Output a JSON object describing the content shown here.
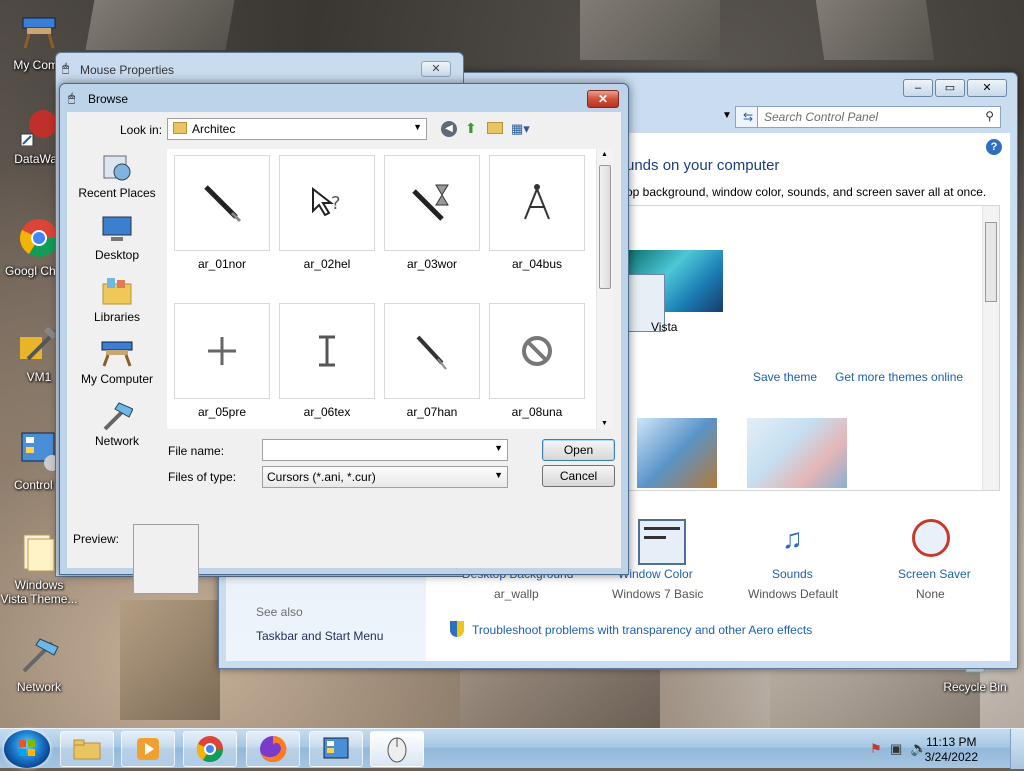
{
  "desktop": {
    "icons": [
      {
        "label": "My Comp",
        "icon": "computer-icon"
      },
      {
        "label": "DataWag",
        "icon": "shortcut-icon"
      },
      {
        "label": "Googl Chron",
        "icon": "chrome-icon"
      },
      {
        "label": "VM1",
        "icon": "tools-icon"
      },
      {
        "label": "Control P",
        "icon": "control-panel-icon"
      },
      {
        "label": "Windows Vista Theme...",
        "icon": "folder-icon"
      },
      {
        "label": "Network",
        "icon": "network-icon"
      },
      {
        "label": "Recycle Bin",
        "icon": "recycle-bin-icon"
      }
    ]
  },
  "control_panel": {
    "search_placeholder": "Search Control Panel",
    "heading": "unds on your computer",
    "subheading": "op background, window color, sounds, and screen saver all at once.",
    "theme_name": "Vista",
    "save_theme": "Save theme",
    "get_more_themes": "Get more themes online",
    "bottom_items": [
      {
        "label": "Desktop Background",
        "value": "ar_wallp"
      },
      {
        "label": "Window Color",
        "value": "Windows 7 Basic"
      },
      {
        "label": "Sounds",
        "value": "Windows Default"
      },
      {
        "label": "Screen Saver",
        "value": "None"
      }
    ],
    "see_also": "See also",
    "taskbar_link": "Taskbar and Start Menu",
    "troubleshoot": "Troubleshoot problems with transparency and other Aero effects"
  },
  "mouse_properties": {
    "title": "Mouse Properties",
    "close": "✕"
  },
  "browse": {
    "title": "Browse",
    "close": "✕",
    "look_in_label": "Look in:",
    "look_in_value": "Architec",
    "places": [
      {
        "label": "Recent Places",
        "icon": "recent-places-icon"
      },
      {
        "label": "Desktop",
        "icon": "desktop-icon"
      },
      {
        "label": "Libraries",
        "icon": "libraries-icon"
      },
      {
        "label": "My Computer",
        "icon": "computer-icon"
      },
      {
        "label": "Network",
        "icon": "network-icon"
      }
    ],
    "files": [
      {
        "name": "ar_01nor",
        "icon": "pencil-cursor-icon"
      },
      {
        "name": "ar_02hel",
        "icon": "help-cursor-icon"
      },
      {
        "name": "ar_03wor",
        "icon": "working-cursor-icon"
      },
      {
        "name": "ar_04bus",
        "icon": "compass-cursor-icon"
      },
      {
        "name": "ar_05pre",
        "icon": "crosshair-cursor-icon"
      },
      {
        "name": "ar_06tex",
        "icon": "text-cursor-icon"
      },
      {
        "name": "ar_07han",
        "icon": "pen-cursor-icon"
      },
      {
        "name": "ar_08una",
        "icon": "unavailable-cursor-icon"
      }
    ],
    "file_name_label": "File name:",
    "file_name_value": "",
    "files_of_type_label": "Files of type:",
    "files_of_type_value": "Cursors (*.ani, *.cur)",
    "open_button": "Open",
    "cancel_button": "Cancel",
    "preview_label": "Preview:"
  },
  "taskbar": {
    "time": "11:13 PM",
    "date": "3/24/2022"
  }
}
